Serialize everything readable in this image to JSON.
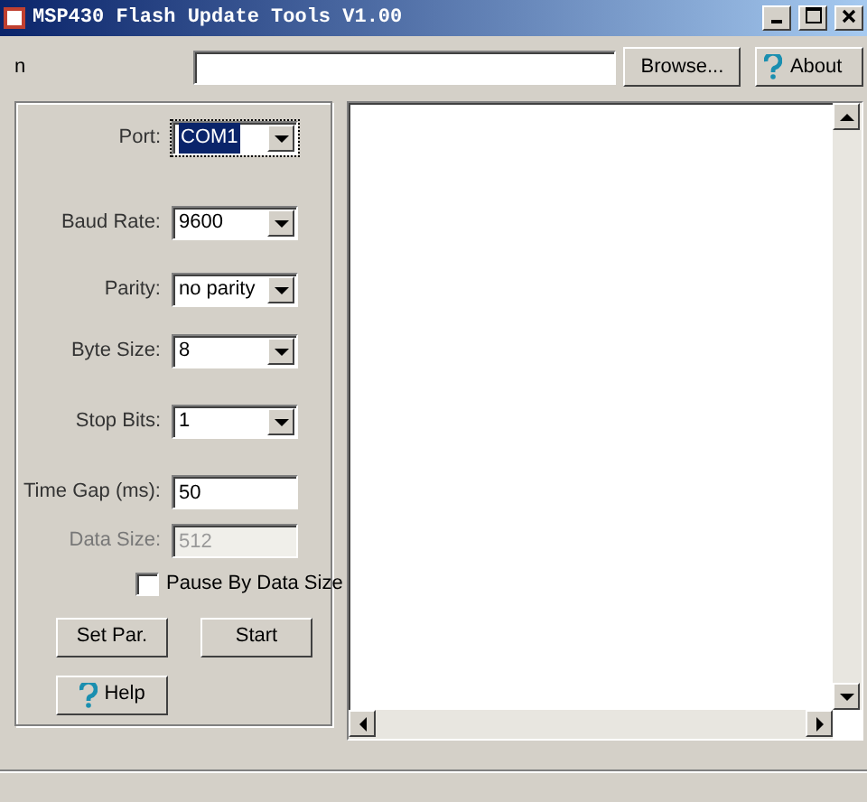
{
  "window": {
    "title": "MSP430 Flash Update Tools V1.00"
  },
  "file_row": {
    "label": "n",
    "browse": "Browse...",
    "about": "About"
  },
  "settings": [
    {
      "kind": "combo",
      "label": "Port:",
      "value": "COM1",
      "selected": true
    },
    {
      "kind": "combo",
      "label": "Baud Rate:",
      "value": "9600",
      "selected": false
    },
    {
      "kind": "combo",
      "label": "Parity:",
      "value": "no parity",
      "selected": false
    },
    {
      "kind": "combo",
      "label": "Byte Size:",
      "value": "8",
      "selected": false
    },
    {
      "kind": "combo",
      "label": "Stop Bits:",
      "value": "1",
      "selected": false
    },
    {
      "kind": "text",
      "label": "Time Gap (ms):",
      "value": "50",
      "disabled": false
    },
    {
      "kind": "text",
      "label": "Data Size:",
      "value": "512",
      "disabled": true
    }
  ],
  "pause_checkbox": {
    "label": "Pause By Data Size",
    "checked": false
  },
  "buttons": [
    "Set Par.",
    "Start"
  ],
  "help": "Help"
}
